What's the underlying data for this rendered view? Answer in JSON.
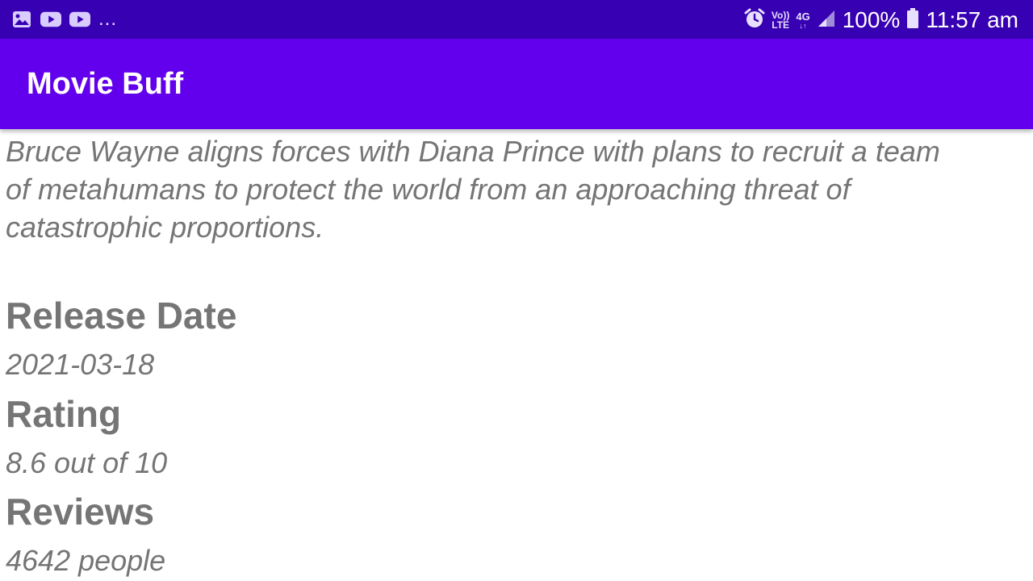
{
  "status_bar": {
    "left_icons": [
      "gallery-icon",
      "youtube-icon",
      "youtube-icon"
    ],
    "more": "...",
    "volte_top": "Vo))",
    "volte_bottom": "LTE",
    "network": "4G",
    "battery_percent": "100%",
    "time": "11:57 am",
    "colors": {
      "background": "#3700b3"
    }
  },
  "app_bar": {
    "title": "Movie Buff",
    "colors": {
      "background": "#6200ee"
    }
  },
  "movie": {
    "overview_lines": [
      "Bruce Wayne aligns forces with Diana Prince with plans to recruit a team",
      "of metahumans to protect the world from an approaching threat of",
      "catastrophic proportions."
    ],
    "release_date_label": "Release Date",
    "release_date": "2021-03-18",
    "rating_label": "Rating",
    "rating": "8.6 out of 10",
    "reviews_label": "Reviews",
    "reviews": "4642 people"
  }
}
